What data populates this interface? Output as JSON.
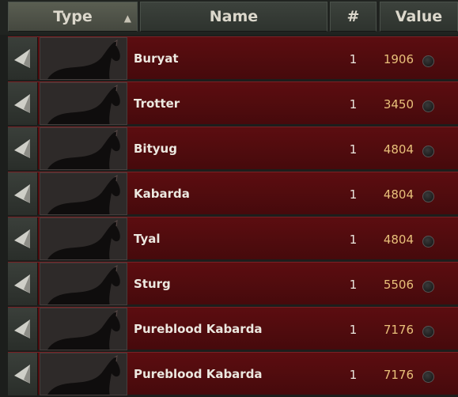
{
  "header": {
    "type_label": "Type",
    "name_label": "Name",
    "count_label": "#",
    "value_label": "Value",
    "sort_indicator": "▲"
  },
  "icons": {
    "row_button": "triangle-left-icon",
    "thumbnail": "horse-icon",
    "currency": "coin-icon"
  },
  "colors": {
    "row_background": "#4f0c0f",
    "value_text": "#e8c07a",
    "header_background": "#2e332e"
  },
  "rows": [
    {
      "name": "Buryat",
      "count": "1",
      "value": "1906"
    },
    {
      "name": "Trotter",
      "count": "1",
      "value": "3450"
    },
    {
      "name": "Bityug",
      "count": "1",
      "value": "4804"
    },
    {
      "name": "Kabarda",
      "count": "1",
      "value": "4804"
    },
    {
      "name": "Tyal",
      "count": "1",
      "value": "4804"
    },
    {
      "name": "Sturg",
      "count": "1",
      "value": "5506"
    },
    {
      "name": "Pureblood Kabarda",
      "count": "1",
      "value": "7176"
    },
    {
      "name": "Pureblood Kabarda",
      "count": "1",
      "value": "7176"
    }
  ]
}
